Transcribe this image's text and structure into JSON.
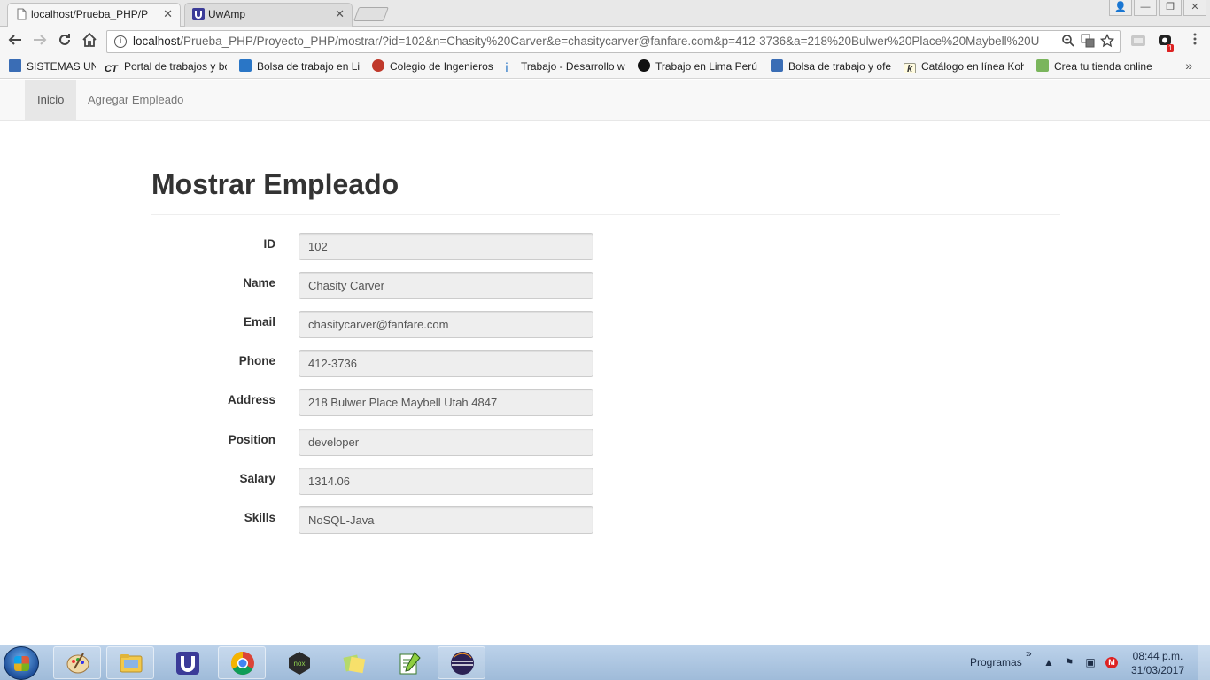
{
  "browser": {
    "tabs": [
      {
        "title": "localhost/Prueba_PHP/P",
        "active": true,
        "icon": "page-icon"
      },
      {
        "title": "UwAmp",
        "active": false,
        "icon": "uwamp-icon"
      }
    ],
    "address_bar": {
      "host": "localhost",
      "path": "/Prueba_PHP/Proyecto_PHP/mostrar/?id=102&n=Chasity%20Carver&e=chasitycarver@fanfare.com&p=412-3736&a=218%20Bulwer%20Place%20Maybell%20U"
    },
    "extension_badge": "1",
    "bookmarks": [
      {
        "label": "SISTEMAS UNI",
        "icon": "folder-icon",
        "color": "#3a6db5"
      },
      {
        "label": "Portal de trabajos y bo",
        "icon": "ct-icon",
        "color": "#222222"
      },
      {
        "label": "Bolsa de trabajo en Lir",
        "icon": "bolsa-icon",
        "color": "#2a76c6"
      },
      {
        "label": "Colegio de Ingenieros",
        "icon": "colegio-icon",
        "color": "#c0392b"
      },
      {
        "label": "Trabajo - Desarrollo w",
        "icon": "trabajo-icon",
        "color": "#2a76c6"
      },
      {
        "label": "Trabajo en Lima Perú",
        "icon": "lima-icon",
        "color": "#111111"
      },
      {
        "label": "Bolsa de trabajo y ofe",
        "icon": "bolsa2-icon",
        "color": "#3a6db5"
      },
      {
        "label": "Catálogo en línea Koh",
        "icon": "koha-icon",
        "color": "#5a5a00"
      },
      {
        "label": "Crea tu tienda online",
        "icon": "shopify-icon",
        "color": "#7ab55c"
      }
    ]
  },
  "app": {
    "nav": [
      {
        "label": "Inicio",
        "active": true
      },
      {
        "label": "Agregar Empleado",
        "active": false
      }
    ],
    "title": "Mostrar Empleado",
    "fields": [
      {
        "label": "ID",
        "value": "102"
      },
      {
        "label": "Name",
        "value": "Chasity Carver"
      },
      {
        "label": "Email",
        "value": "chasitycarver@fanfare.com"
      },
      {
        "label": "Phone",
        "value": "412-3736"
      },
      {
        "label": "Address",
        "value": "218 Bulwer Place Maybell Utah 4847"
      },
      {
        "label": "Position",
        "value": "developer"
      },
      {
        "label": "Salary",
        "value": "1314.06"
      },
      {
        "label": "Skills",
        "value": "NoSQL-Java"
      }
    ]
  },
  "taskbar": {
    "apps": [
      "paint-icon",
      "explorer-icon",
      "uwamp-icon",
      "chrome-icon",
      "nox-icon",
      "sticky-notes-icon",
      "notepadpp-icon",
      "eclipse-icon"
    ],
    "tray_label": "Programas",
    "time": "08:44 p.m.",
    "date": "31/03/2017"
  }
}
